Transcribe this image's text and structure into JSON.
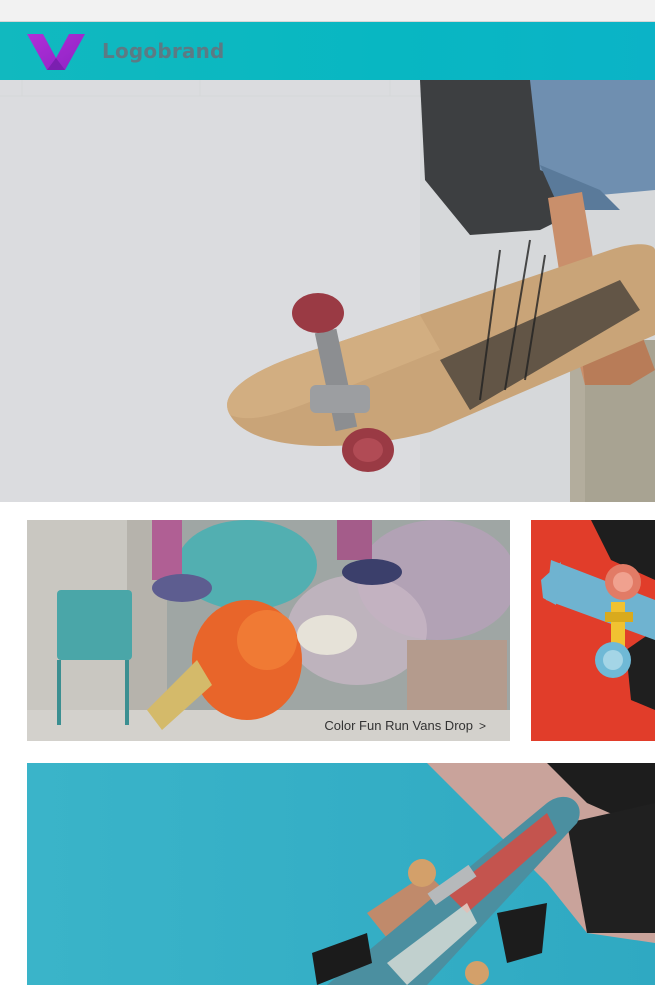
{
  "header": {
    "brand_name": "Logobrand",
    "logo_icon": "v-logo-icon",
    "background_color": "#0bb7c3",
    "logo_color": "#a02bd6"
  },
  "hero": {
    "image_alt": "Person carrying a longboard skateboard against a white wall"
  },
  "tiles": [
    {
      "image_alt": "Skater jumping through colored powder",
      "caption": "Color Fun Run Vans Drop",
      "caption_icon": "chevron-right-icon",
      "caption_glyph": ">"
    },
    {
      "image_alt": "Skateboard held against red background"
    },
    {
      "image_alt": "Skater mid-air against blue sky"
    }
  ]
}
